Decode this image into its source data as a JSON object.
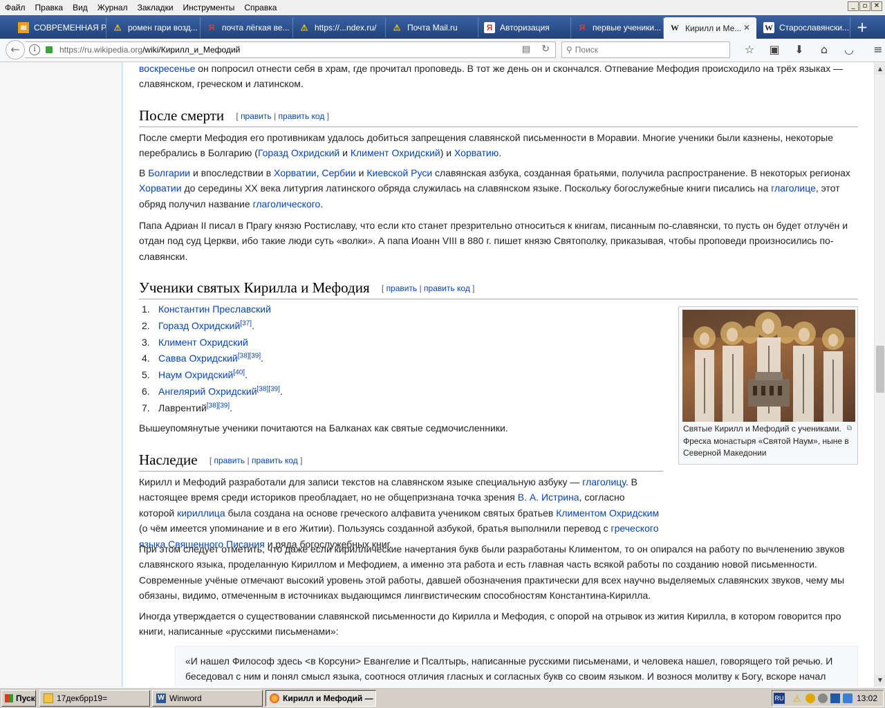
{
  "menubar": {
    "items": [
      "Файл",
      "Правка",
      "Вид",
      "Журнал",
      "Закладки",
      "Инструменты",
      "Справка"
    ]
  },
  "tabs": [
    {
      "label": "СОВРЕМЕННАЯ Р...",
      "icon": "rss-icon"
    },
    {
      "label": "ромен гари возд...",
      "icon": "warning-icon"
    },
    {
      "label": "почта лёгкая ве...",
      "icon": "yandex-icon"
    },
    {
      "label": "https://...ndex.ru/",
      "icon": "warning-icon"
    },
    {
      "label": "Почта Mail.ru",
      "icon": "warning-icon"
    },
    {
      "label": "Авторизация",
      "icon": "yandex-icon"
    },
    {
      "label": "первые ученики...",
      "icon": "yandex-icon"
    },
    {
      "label": "Кирилл и Ме...",
      "icon": "wikipedia-icon",
      "active": true
    },
    {
      "label": "Старославянски...",
      "icon": "wikipedia-icon"
    }
  ],
  "nav": {
    "url_host": "https://ru.wikipedia.org",
    "url_path": "/wiki/Кирилл_и_Мефодий",
    "search_placeholder": "Поиск"
  },
  "article": {
    "top_line1_link": "воскресенье",
    "top_line1_text": " он попросил отнести себя в храм, где прочитал проповедь. В тот же день он и скончался. Отпевание Мефодия происходило на трёх языках —",
    "top_line2": "славянском, греческом и латинском.",
    "sec1_title": "После смерти",
    "edit": "[ править | править код ]",
    "edit_a": "править",
    "edit_b": "править код",
    "p1": {
      "t1": "После смерти Мефодия его противникам удалось добиться запрещения славянской письменности в Моравии. Многие ученики были казнены, некоторые перебрались в Болгарию (",
      "l1": "Горазд Охридский",
      "t2": " и ",
      "l2": "Климент Охридский",
      "t3": ") и ",
      "l3": "Хорватию",
      "t4": "."
    },
    "p2": {
      "t1": "В ",
      "l1": "Болгарии",
      "t2": " и впоследствии в ",
      "l2": "Хорватии",
      "t3": ", ",
      "l3": "Сербии",
      "t4": " и ",
      "l4": "Киевской Руси",
      "t5": " славянская азбука, созданная братьями, получила распространение. В некоторых регионах ",
      "l5": "Хорватии",
      "t6": " до середины XX века литургия латинского обряда служилась на славянском языке. Поскольку богослужебные книги писались на ",
      "l6": "глаголице",
      "t7": ", этот обряд получил название ",
      "l7": "глаголического",
      "t8": "."
    },
    "p3": "Папа Адриан II писал в Прагу князю Ростиславу, что если кто станет презрительно относиться к книгам, писанным по-славянски, то пусть он будет отлучён и отдан под суд Церкви, ибо такие люди суть «волки». А папа Иоанн VIII в 880 г. пишет князю Святополку, приказывая, чтобы проповеди произносились по-славянски.",
    "sec2_title": "Ученики святых Кирилла и Мефодия",
    "students": [
      {
        "n": "1.",
        "name": "Константин Преславский",
        "sup": "",
        "link": true
      },
      {
        "n": "2.",
        "name": "Горазд Охридский",
        "sup": "[37]",
        "link": true
      },
      {
        "n": "3.",
        "name": "Климент Охридский",
        "sup": "",
        "link": true
      },
      {
        "n": "4.",
        "name": "Савва Охридский",
        "sup": "[38][39]",
        "link": true
      },
      {
        "n": "5.",
        "name": "Наум Охридский",
        "sup": "[40]",
        "link": true
      },
      {
        "n": "6.",
        "name": "Ангелярий Охридский",
        "sup": "[38][39]",
        "link": true
      },
      {
        "n": "7.",
        "name": "Лаврентий",
        "sup": "[38][39]",
        "link": false
      }
    ],
    "students_after": "Вышеупомянутые ученики почитаются на Балканах как святые седмочисленники.",
    "thumb_caption": "Святые Кирилл и Мефодий с учениками. Фреска монастыря «Святой Наум», ныне в Северной Македонии",
    "sec3_title": "Наследие",
    "p4": {
      "t1": "Кирилл и Мефодий разработали для записи текстов на славянском языке специальную азбуку — ",
      "l1": "глаголицу",
      "t2": ". В настоящее время среди историков преобладает, но не общепризнана точка зрения ",
      "l2": "В. А. Истрина",
      "t3": ", согласно которой ",
      "l3": "кириллица",
      "t4": " была создана на основе греческого алфавита учеником святых братьев ",
      "l4": "Климентом Охридским",
      "t5": " (о чём имеется упоминание и в его Житии). Пользуясь созданной азбукой, братья выполнили перевод с ",
      "l5": "греческого языка",
      "t6": " ",
      "l6": "Священного Писания",
      "t7": " и ряда богослужебных книг."
    },
    "p5": "При этом следует отметить, что даже если кириллические начертания букв были разработаны Климентом, то он опирался на работу по вычленению звуков славянского языка, проделанную Кириллом и Мефодием, а именно эта работа и есть главная часть всякой работы по созданию новой письменности. Современные учёные отмечают высокий уровень этой работы, давшей обозначения практически для всех научно выделяемых славянских звуков, чему мы обязаны, видимо, отмеченным в источниках выдающимся лингвистическим способностям Константина-Кирилла.",
    "p6": "Иногда утверждается о существовании славянской письменности до Кирилла и Мефодия, с опорой на отрывок из жития Кирилла, в котором говорится про книги, написанные «русскими письменами»:",
    "quote": "«И нашел Философ здесь <в Корсуни> Евангелие и Псалтырь, написанные русскими письменами, и человека нашел, говорящего той речью. И беседовал с ним и понял смысл языка, соотнося отличия гласных и согласных букв со своим языком. И вознося молитву к Богу, вскоре начал"
  },
  "taskbar": {
    "start": "Пуск",
    "tasks": [
      {
        "label": "17декбрр19=",
        "icon": "folder-icon"
      },
      {
        "label": "Winword",
        "icon": "word-icon"
      },
      {
        "label": "Кирилл и Мефодий — ...",
        "icon": "firefox-icon",
        "active": true
      }
    ],
    "lang": "RU",
    "clock": "13:02"
  },
  "colors": {
    "link": "#0645ad",
    "tabbar": "#2b4f86",
    "taskbar": "#d4d0c8"
  }
}
